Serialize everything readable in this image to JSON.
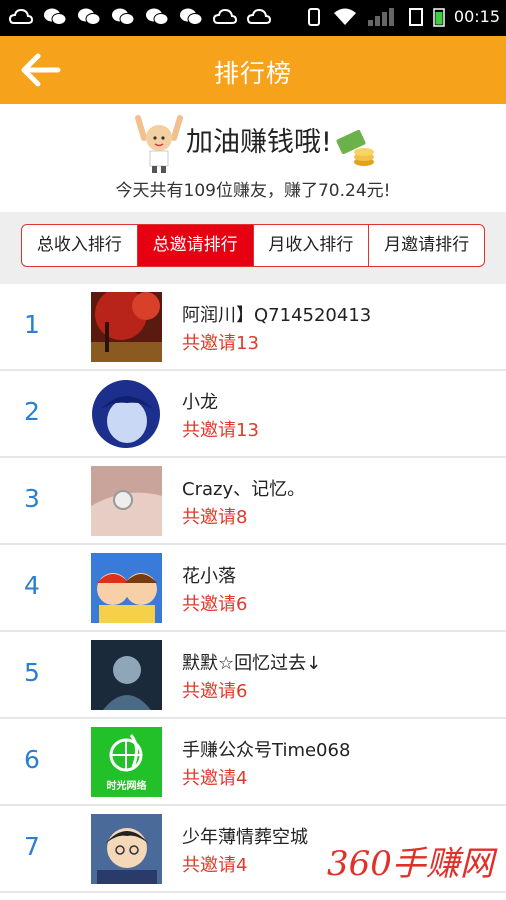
{
  "status_bar": {
    "time": "00:15"
  },
  "app_bar": {
    "title": "排行榜"
  },
  "banner": {
    "headline": "加油赚钱哦!",
    "summary": "今天共有109位赚友，赚了70.24元!"
  },
  "tabs": [
    {
      "label": "总收入排行",
      "active": false
    },
    {
      "label": "总邀请排行",
      "active": true
    },
    {
      "label": "月收入排行",
      "active": false
    },
    {
      "label": "月邀请排行",
      "active": false
    }
  ],
  "ranking": [
    {
      "rank": "1",
      "name": "阿润川】Q714520413",
      "invites": "共邀请13"
    },
    {
      "rank": "2",
      "name": "小龙",
      "invites": "共邀请13"
    },
    {
      "rank": "3",
      "name": "Crazy、记忆。",
      "invites": "共邀请8"
    },
    {
      "rank": "4",
      "name": "花小落",
      "invites": "共邀请6"
    },
    {
      "rank": "5",
      "name": "默默☆回忆过去↓",
      "invites": "共邀请6"
    },
    {
      "rank": "6",
      "name": "手赚公众号Time068",
      "invites": "共邀请4",
      "avatar_text": "时光网络"
    },
    {
      "rank": "7",
      "name": "少年薄情葬空城",
      "invites": "共邀请4"
    }
  ],
  "watermark": "360手赚网",
  "colors": {
    "accent": "#f6a21a",
    "active_tab": "#e60012",
    "rank": "#2a7fd0",
    "invite": "#e03a2a"
  }
}
